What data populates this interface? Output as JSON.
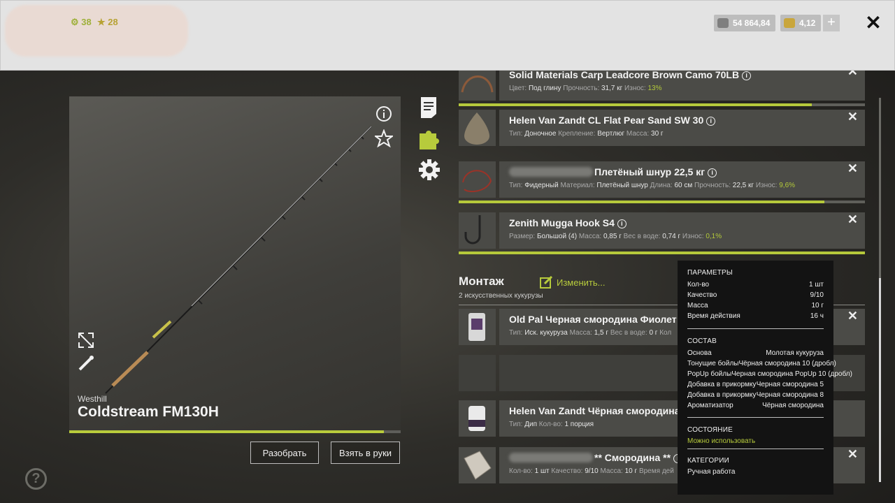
{
  "header": {
    "level": "38",
    "stars": "28",
    "silver": "54 864,84",
    "gold": "4,12",
    "plus": "+",
    "close": "✕"
  },
  "rod": {
    "brand": "Westhill",
    "name": "Coldstream FM130H",
    "wear_fraction": 0.95,
    "disassemble_label": "Разобрать",
    "take_label": "Взять в руки"
  },
  "tackle": [
    {
      "title": "Solid Materials Carp Leadcore Brown Camo 70LB",
      "props": [
        [
          "Цвет:",
          "Под глину"
        ],
        [
          "Прочность:",
          "31,7 кг"
        ],
        [
          "Износ:",
          "13%"
        ]
      ],
      "wear_fraction": 0.87
    },
    {
      "title": "Helen Van Zandt CL Flat Pear Sand SW 30",
      "props": [
        [
          "Тип:",
          "Доночное"
        ],
        [
          "Крепление:",
          "Вертлюг"
        ],
        [
          "Масса:",
          "30 г"
        ]
      ]
    },
    {
      "title": "Плетёный шнур 22,5 кг",
      "props": [
        [
          "Тип:",
          "Фидерный"
        ],
        [
          "Материал:",
          "Плетёный шнур"
        ],
        [
          "Длина:",
          "60 см"
        ],
        [
          "Прочность:",
          "22,5 кг"
        ],
        [
          "Износ:",
          "9,6%"
        ]
      ],
      "wear_fraction": 0.9
    },
    {
      "title": "Zenith Mugga Hook S4",
      "props": [
        [
          "Размер:",
          "Большой (4)"
        ],
        [
          "Масса:",
          "0,85 г"
        ],
        [
          "Вес в воде:",
          "0,74 г"
        ],
        [
          "Износ:",
          "0,1%"
        ]
      ],
      "wear_fraction": 1.0
    }
  ],
  "montage": {
    "title": "Монтаж",
    "subtitle": "2 искусственных кукурузы",
    "edit_label": "Изменить...",
    "items": [
      {
        "title": "Old Pal Черная смородина Фиолет",
        "props": [
          [
            "Тип:",
            "Иск. кукуруза"
          ],
          [
            "Масса:",
            "1,5 г"
          ],
          [
            "Вес в воде:",
            "0 г"
          ],
          [
            "Кол",
            ""
          ]
        ]
      },
      {
        "title": "Helen Van Zandt Чёрная смородина",
        "props": [
          [
            "Тип:",
            "Дип"
          ],
          [
            "Кол-во:",
            "1 порция"
          ]
        ]
      },
      {
        "title": "** Смородина **",
        "props": [
          [
            "Кол-во:",
            "1 шт"
          ],
          [
            "Качество:",
            "9/10"
          ],
          [
            "Масса:",
            "10 г"
          ],
          [
            "Время дей",
            ""
          ]
        ]
      }
    ]
  },
  "tooltip": {
    "params_title": "ПАРАМЕТРЫ",
    "params": [
      [
        "Кол-во",
        "1 шт"
      ],
      [
        "Качество",
        "9/10"
      ],
      [
        "Масса",
        "10 г"
      ],
      [
        "Время действия",
        "16 ч"
      ]
    ],
    "composition_title": "СОСТАВ",
    "composition": [
      [
        "Основа",
        "Молотая кукуруза"
      ],
      [
        "Тонущие бойлы",
        "Чёрная смородина 10 (дробл)"
      ],
      [
        "PopUp бойлы",
        "Черная смородина PopUp 10 (дробл)"
      ],
      [
        "Добавка в прикормку",
        "Черная смородина 5"
      ],
      [
        "Добавка в прикормку",
        "Черная смородина 8"
      ],
      [
        "Ароматизатор",
        "Чёрная смородина"
      ]
    ],
    "state_title": "СОСТОЯНИЕ",
    "state": "Можно использовать",
    "category_title": "КАТЕГОРИИ",
    "category": "Ручная работа"
  },
  "colors": {
    "accent": "#b7cb3c",
    "card": "#4b4b47",
    "tooltip_bg": "#131313"
  }
}
